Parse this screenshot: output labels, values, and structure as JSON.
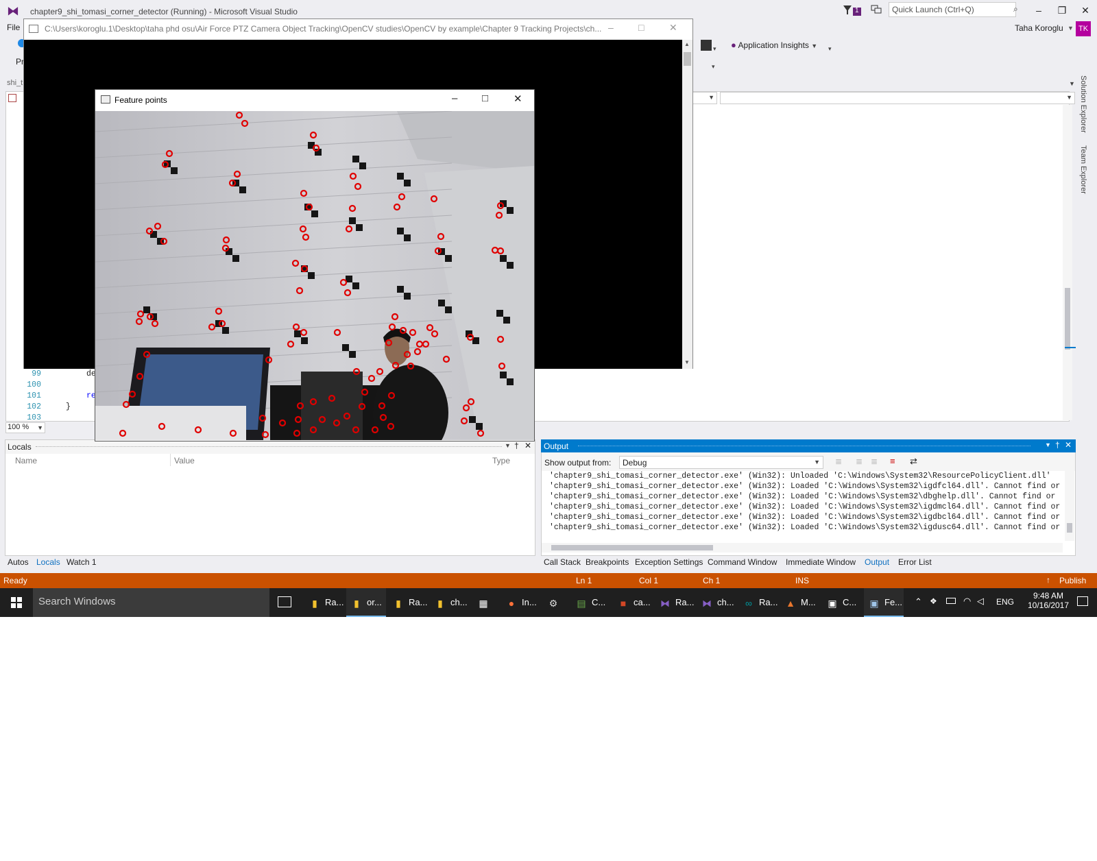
{
  "vs": {
    "title": "chapter9_shi_tomasi_corner_detector (Running) - Microsoft Visual Studio",
    "notification_count": "1",
    "quick_launch_placeholder": "Quick Launch (Ctrl+Q)",
    "menu_file": "File",
    "user_name": "Taha Koroglu",
    "user_initials": "TK",
    "app_insights": "Application Insights",
    "left_stub_1": "Pr",
    "doc_tab": "shi_t",
    "side_tabs": [
      "Solution Explorer",
      "Team Explorer"
    ],
    "zoom": "100 %"
  },
  "code": {
    "lines": [
      {
        "num": "99",
        "text": "de"
      },
      {
        "num": "100",
        "text": ""
      },
      {
        "num": "101",
        "text": "re"
      },
      {
        "num": "102",
        "text": "}"
      },
      {
        "num": "103",
        "text": ""
      }
    ]
  },
  "locals": {
    "title": "Locals",
    "col_name": "Name",
    "col_value": "Value",
    "col_type": "Type",
    "tabs": [
      "Autos",
      "Locals",
      "Watch 1"
    ]
  },
  "output": {
    "title": "Output",
    "show_from_label": "Show output from:",
    "source": "Debug",
    "lines": [
      "'chapter9_shi_tomasi_corner_detector.exe' (Win32): Unloaded 'C:\\Windows\\System32\\ResourcePolicyClient.dll'",
      "'chapter9_shi_tomasi_corner_detector.exe' (Win32): Loaded 'C:\\Windows\\System32\\igdfcl64.dll'. Cannot find or",
      "'chapter9_shi_tomasi_corner_detector.exe' (Win32): Loaded 'C:\\Windows\\System32\\dbghelp.dll'. Cannot find or",
      "'chapter9_shi_tomasi_corner_detector.exe' (Win32): Loaded 'C:\\Windows\\System32\\igdmcl64.dll'. Cannot find or",
      "'chapter9_shi_tomasi_corner_detector.exe' (Win32): Loaded 'C:\\Windows\\System32\\igdbcl64.dll'. Cannot find or",
      "'chapter9_shi_tomasi_corner_detector.exe' (Win32): Loaded 'C:\\Windows\\System32\\igdusc64.dll'. Cannot find or"
    ],
    "tabs": [
      "Call Stack",
      "Breakpoints",
      "Exception Settings",
      "Command Window",
      "Immediate Window",
      "Output",
      "Error List"
    ]
  },
  "status": {
    "ready": "Ready",
    "ln": "Ln 1",
    "col": "Col 1",
    "ch": "Ch 1",
    "ins": "INS",
    "publish": "Publish"
  },
  "console_window": {
    "path": "C:\\Users\\koroglu.1\\Desktop\\taha phd osu\\Air Force PTZ Camera Object Tracking\\OpenCV studies\\OpenCV by example\\Chapter 9 Tracking Projects\\ch..."
  },
  "feature_window": {
    "title": "Feature points"
  },
  "taskbar": {
    "search": "Search Windows",
    "items": [
      "Ra...",
      "or...",
      "Ra...",
      "ch...",
      "",
      "In...",
      "",
      "C...",
      "ca...",
      "Ra...",
      "ch...",
      "Ra...",
      "M...",
      "C...",
      "Fe..."
    ],
    "lang": "ENG",
    "time": "9:48 AM",
    "date": "10/16/2017"
  },
  "colors": {
    "status_bar": "#ca5100",
    "output_header": "#007acc",
    "taskbar": "#1f1f1f",
    "feature_marker": "#e00000"
  }
}
